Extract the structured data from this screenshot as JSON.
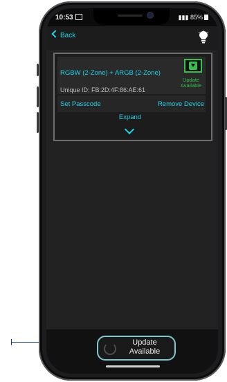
{
  "status_bar": {
    "time": "10:53",
    "battery": "85%"
  },
  "nav": {
    "back_label": "Back",
    "lightbulb_icon": "lightbulb-icon"
  },
  "device": {
    "name": "RGBW (2-Zone) + ARGB (2-Zone)",
    "unique_id": "Unique ID: FB:2D:4F:86:AE:61",
    "update_icon": "download-icon",
    "update_label": "Update Available",
    "set_passcode": "Set Passcode",
    "remove_device": "Remove Device",
    "expand": "Expand"
  },
  "bottom": {
    "update_button_label": "Update Available",
    "refresh_icon": "refresh-icon"
  },
  "colors": {
    "accent": "#1fd3e6",
    "update_green": "#34c04d"
  }
}
